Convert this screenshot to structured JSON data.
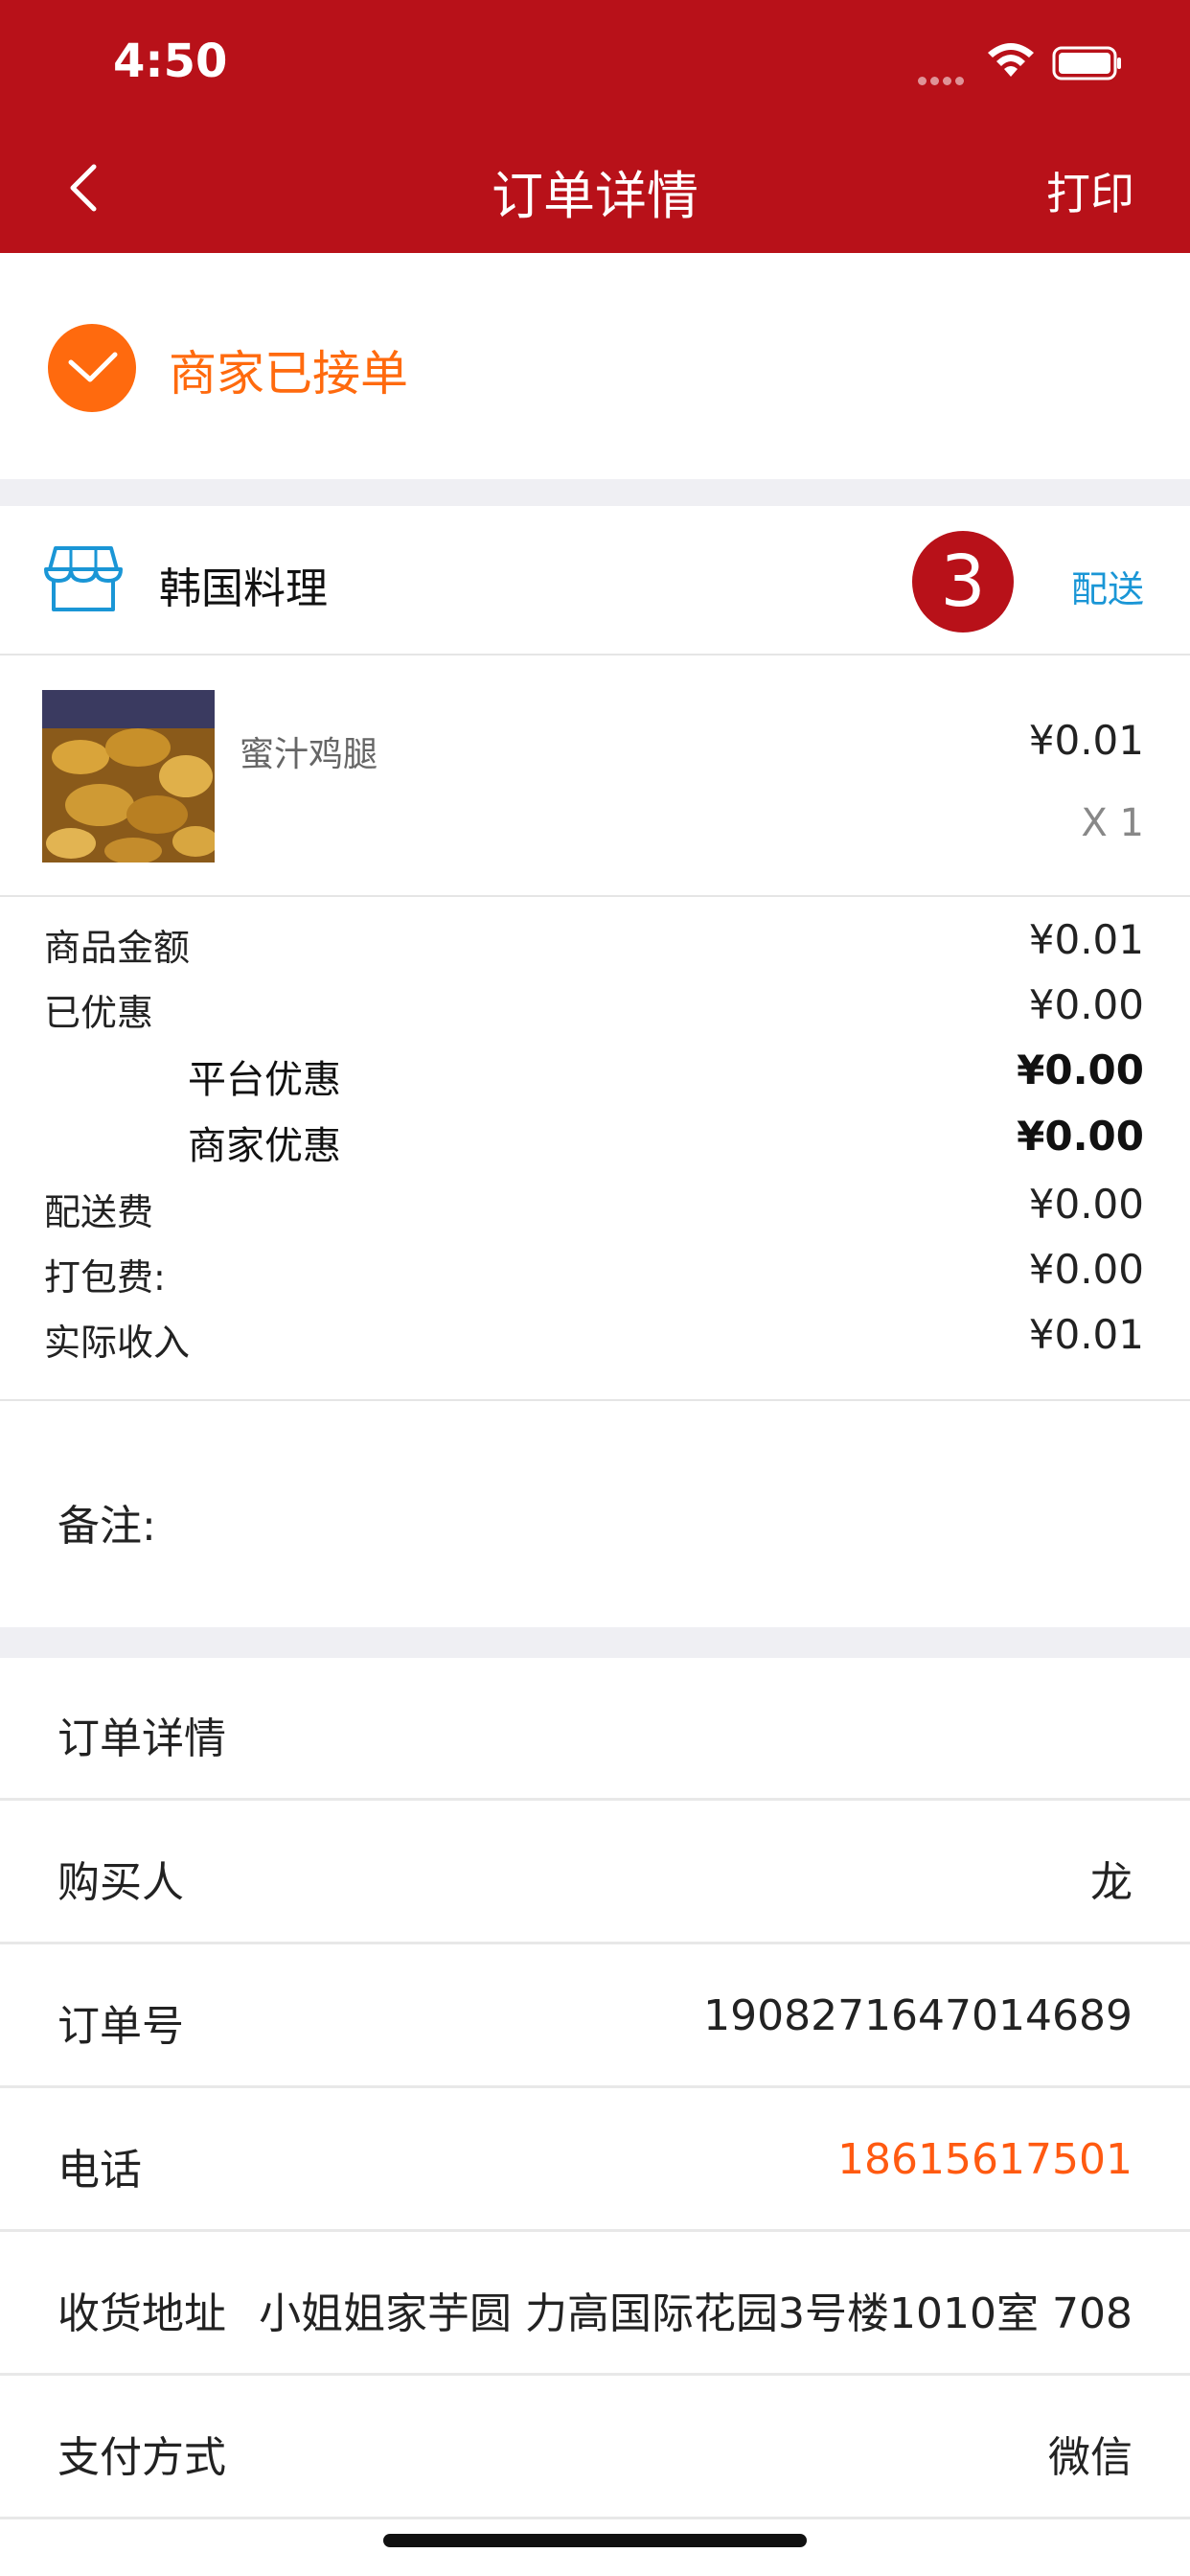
{
  "status_bar": {
    "time": "4:50"
  },
  "nav": {
    "title": "订单详情",
    "print_label": "打印"
  },
  "order_status": {
    "text": "商家已接单"
  },
  "shop": {
    "name": "韩国料理",
    "badge": "3",
    "delivery_label": "配送"
  },
  "item": {
    "name": "蜜汁鸡腿",
    "price": "¥0.01",
    "qty": "X 1"
  },
  "summary": [
    {
      "label": "商品金额",
      "value": "¥0.01"
    },
    {
      "label": "已优惠",
      "value": "¥0.00"
    },
    {
      "label": "平台优惠",
      "value": "¥0.00"
    },
    {
      "label": "商家优惠",
      "value": "¥0.00"
    },
    {
      "label": "配送费",
      "value": "¥0.00"
    },
    {
      "label": "打包费:",
      "value": "¥0.00"
    },
    {
      "label": "实际收入",
      "value": "¥0.01"
    }
  ],
  "remarks_label": "备注:",
  "details": {
    "title": "订单详情",
    "buyer": {
      "label": "购买人",
      "value": "龙"
    },
    "order_no": {
      "label": "订单号",
      "value": "1908271647014689"
    },
    "phone": {
      "label": "电话",
      "value": "18615617501"
    },
    "address": {
      "label": "收货地址",
      "value": "小姐姐家芋圆 力高国际花园3号楼1010室 708"
    },
    "payment": {
      "label": "支付方式",
      "value": "微信"
    }
  },
  "colors": {
    "header": "#b81119",
    "accent_orange": "#ff6a0e",
    "link_blue": "#1a96d6"
  },
  "icons": [
    "back-icon",
    "check-icon",
    "shop-icon",
    "wifi-icon",
    "battery-icon"
  ]
}
